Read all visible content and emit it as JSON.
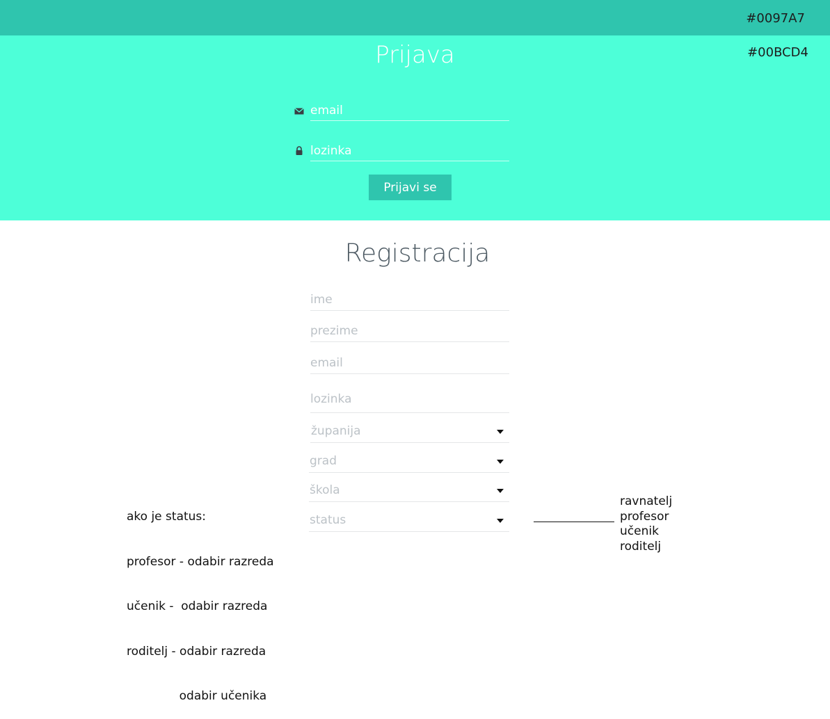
{
  "colors": {
    "dark": "#0097A7",
    "light": "#00BCD4"
  },
  "swatches": {
    "dark_label": "#0097A7",
    "light_label": "#00BCD4"
  },
  "login": {
    "title": "Prijava",
    "email_placeholder": "email",
    "password_placeholder": "lozinka",
    "button": "Prijavi se",
    "icons": [
      "mail-icon",
      "lock-icon"
    ]
  },
  "register": {
    "title": "Registracija",
    "ime_placeholder": "ime",
    "prezime_placeholder": "prezime",
    "email_placeholder": "email",
    "password_placeholder": "lozinka",
    "zupanija": "županija",
    "grad": "grad",
    "skola": "škola",
    "status": "status"
  },
  "note": {
    "lines": [
      "ako je status:",
      "profesor - odabir razreda",
      "učenik -  odabir razreda",
      "roditelj - odabir razreda",
      "              odabir učenika"
    ]
  },
  "status_options": [
    "ravnatelj",
    "profesor",
    "učenik",
    "roditelj"
  ]
}
